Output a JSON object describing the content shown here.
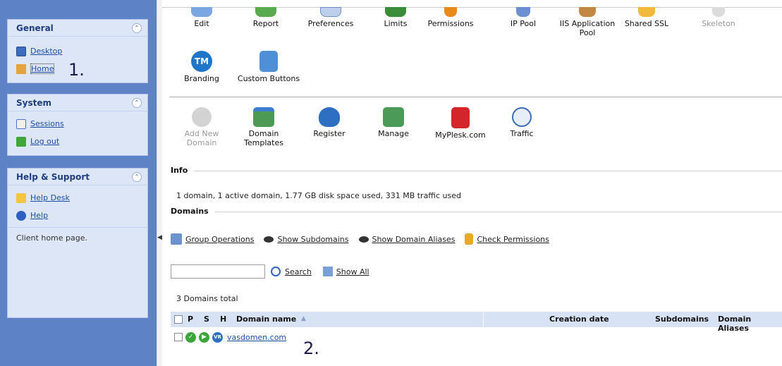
{
  "sidebar": {
    "general": {
      "title": "General",
      "items": [
        {
          "label": "Desktop",
          "icon": "desktop-icon"
        },
        {
          "label": "Home",
          "icon": "home-icon"
        }
      ],
      "annotation": "1."
    },
    "system": {
      "title": "System",
      "items": [
        {
          "label": "Sessions",
          "icon": "sessions-icon"
        },
        {
          "label": "Log out",
          "icon": "logout-icon"
        }
      ]
    },
    "help": {
      "title": "Help & Support",
      "items": [
        {
          "label": "Help Desk",
          "icon": "help-desk-icon"
        },
        {
          "label": "Help",
          "icon": "help-icon"
        }
      ],
      "description": "Client home page."
    }
  },
  "tools_row1": [
    {
      "label": "Edit",
      "icon": "edit-icon"
    },
    {
      "label": "Report",
      "icon": "report-icon"
    },
    {
      "label": "Preferences",
      "icon": "preferences-icon"
    },
    {
      "label": "Limits",
      "icon": "limits-icon"
    },
    {
      "label": "Permissions",
      "icon": "permissions-icon"
    },
    {
      "label": "IP Pool",
      "icon": "ip-pool-icon"
    },
    {
      "label": "IIS Application Pool",
      "icon": "iis-pool-icon"
    },
    {
      "label": "Shared SSL",
      "icon": "shared-ssl-icon"
    },
    {
      "label": "Skeleton",
      "icon": "skeleton-icon",
      "disabled": true
    }
  ],
  "tools_row2": [
    {
      "label": "Branding",
      "icon": "branding-icon",
      "badge": "TM"
    },
    {
      "label": "Custom Buttons",
      "icon": "custom-buttons-icon"
    }
  ],
  "tools_row3": [
    {
      "label": "Add New Domain",
      "icon": "add-domain-icon",
      "disabled": true
    },
    {
      "label": "Domain Templates",
      "icon": "domain-templates-icon"
    },
    {
      "label": "Register",
      "icon": "register-icon"
    },
    {
      "label": "Manage",
      "icon": "manage-icon"
    },
    {
      "label": "MyPlesk.com",
      "icon": "myplesk-icon"
    },
    {
      "label": "Traffic",
      "icon": "traffic-icon"
    }
  ],
  "info": {
    "title": "Info",
    "text": "1 domain, 1 active domain, 1.77 GB disk space used, 331 MB traffic used"
  },
  "domains": {
    "title": "Domains",
    "ops": [
      {
        "label": "Group Operations",
        "icon": "group-operations-icon"
      },
      {
        "label": "Show Subdomains",
        "icon": "eye-icon"
      },
      {
        "label": "Show Domain Aliases",
        "icon": "eye-icon"
      },
      {
        "label": "Check Permissions",
        "icon": "lock-icon"
      }
    ],
    "search": {
      "value": "",
      "button": "Search",
      "show_all": "Show All"
    },
    "total": "3 Domains total",
    "columns": {
      "p": "P",
      "s": "S",
      "h": "H",
      "name": "Domain name",
      "sort": "▲",
      "creation": "Creation date",
      "subdomains": "Subdomains",
      "aliases": "Domain Aliases"
    },
    "rows": [
      {
        "name": "vasdomen.com",
        "hosting": "VR"
      }
    ],
    "annotation": "2."
  },
  "colors": {
    "sidebar_bg": "#5d82c6",
    "panel_bg": "#dde6f6",
    "link": "#1b4da7",
    "table_header": "#d7e2f4"
  }
}
